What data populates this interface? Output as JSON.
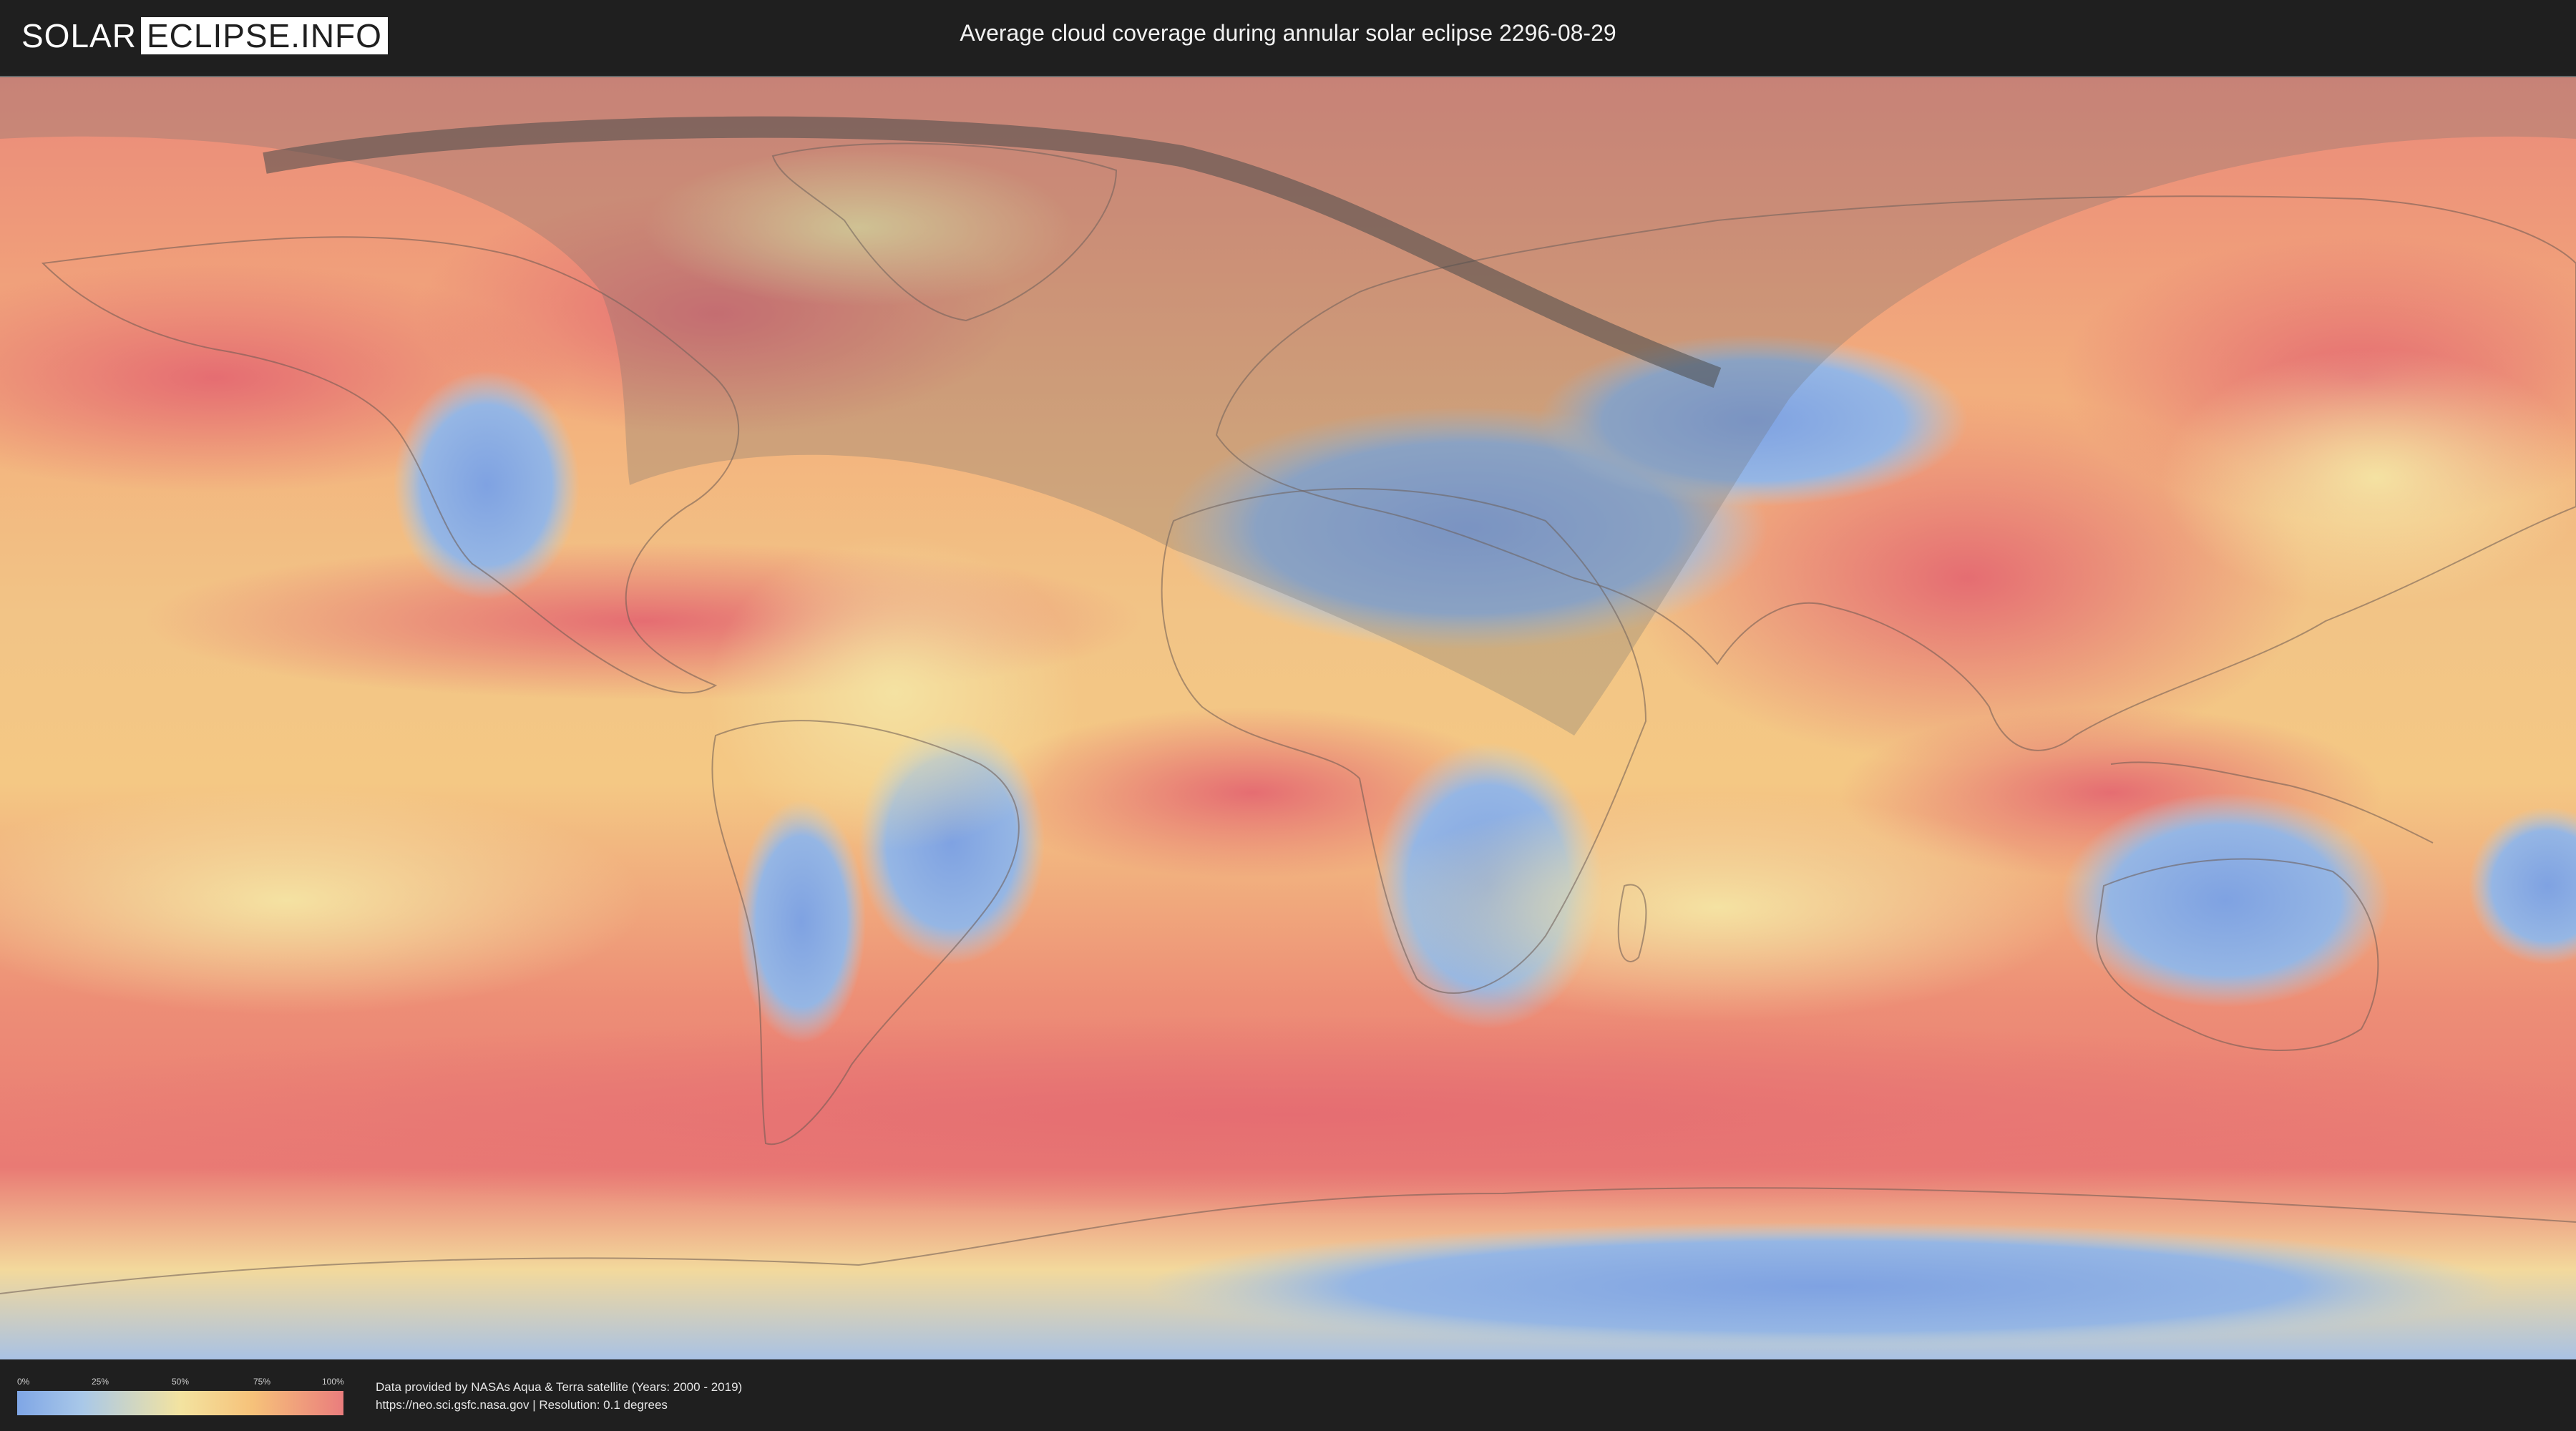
{
  "header": {
    "logo_left": "SOLAR",
    "logo_right": "ECLIPSE.INFO",
    "title": "Average cloud coverage during annular solar eclipse 2296-08-29"
  },
  "legend": {
    "ticks": [
      "0%",
      "25%",
      "50%",
      "75%",
      "100%"
    ],
    "colors": [
      "#7fa6e6",
      "#a9c8e8",
      "#f3e3a0",
      "#f6c27a",
      "#ea7d7d"
    ]
  },
  "footer": {
    "credit_line1": "Data provided by NASAs Aqua & Terra satellite (Years: 2000 - 2019)",
    "credit_line2": "https://neo.sci.gsfc.nasa.gov | Resolution: 0.1 degrees"
  },
  "map": {
    "ocean_color": "#f0a070",
    "clear_color": "#7fa6e6",
    "cloudy_color": "#ea7d7d",
    "eclipse_shadow_color": "#5a5a5a"
  }
}
